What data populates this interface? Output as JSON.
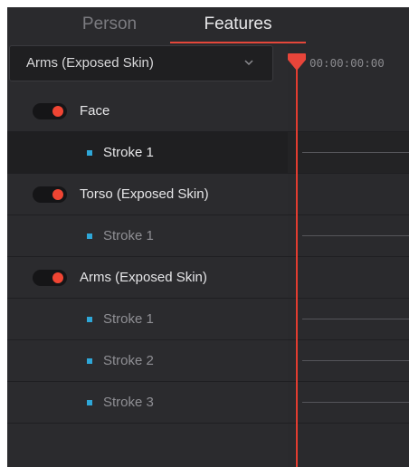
{
  "tabs": [
    {
      "label": "Person",
      "active": false
    },
    {
      "label": "Features",
      "active": true
    }
  ],
  "dropdown": {
    "selected": "Arms (Exposed Skin)"
  },
  "timecode": "00:00:00:00",
  "features": [
    {
      "label": "Face",
      "enabled": true,
      "strokes": [
        {
          "label": "Stroke 1",
          "selected": true
        }
      ]
    },
    {
      "label": "Torso (Exposed Skin)",
      "enabled": true,
      "strokes": [
        {
          "label": "Stroke 1",
          "selected": false
        }
      ]
    },
    {
      "label": "Arms (Exposed Skin)",
      "enabled": true,
      "strokes": [
        {
          "label": "Stroke 1",
          "selected": false
        },
        {
          "label": "Stroke 2",
          "selected": false
        },
        {
          "label": "Stroke 3",
          "selected": false
        }
      ]
    }
  ],
  "colors": {
    "accent_red": "#e5473a",
    "stroke_blue": "#2ea7d8",
    "panel_bg": "#28282b"
  },
  "icons": {
    "dropdown": "chevron-down-icon",
    "toggle": "toggle-switch",
    "playhead": "playhead-marker-icon",
    "stroke": "stroke-square-icon"
  }
}
